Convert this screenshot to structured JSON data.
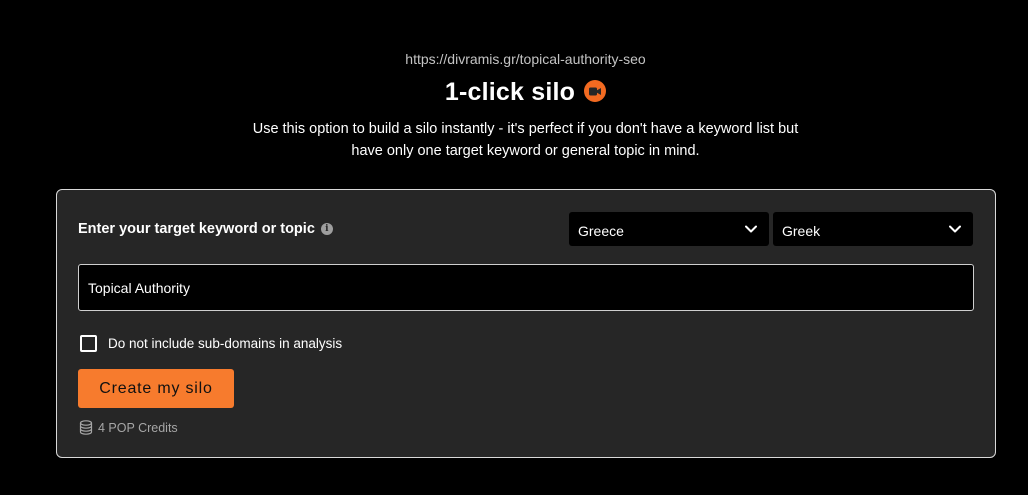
{
  "header": {
    "url": "https://divramis.gr/topical-authority-seo",
    "title": "1-click silo",
    "description_line1": "Use this option to build a silo instantly - it's perfect if you don't have a keyword list but",
    "description_line2": "have only one target keyword or general topic in mind."
  },
  "form": {
    "keyword_label": "Enter your target keyword or topic",
    "country": "Greece",
    "language": "Greek",
    "keyword_value": "Topical Authority",
    "subdomain_checkbox_label": "Do not include sub-domains in analysis",
    "subdomain_checked": false,
    "create_button_label": "Create my silo",
    "credits_text": "4 POP Credits"
  },
  "colors": {
    "accent": "#f77b2d",
    "video_icon": "#f26a21",
    "card_bg": "#262626",
    "page_bg": "#000000"
  },
  "icons": {
    "title_icon": "video-camera-icon",
    "info": "info-icon",
    "select_chevron": "chevron-down-icon",
    "credits": "database-icon"
  }
}
